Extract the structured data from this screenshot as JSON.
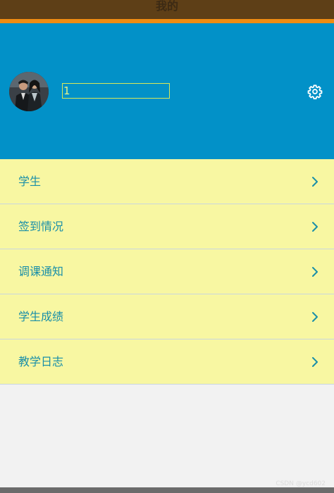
{
  "topbar": {
    "title": "我的"
  },
  "profile": {
    "username": "1"
  },
  "menu": {
    "items": [
      {
        "label": "学生"
      },
      {
        "label": "签到情况"
      },
      {
        "label": "调课通知"
      },
      {
        "label": "学生成绩"
      },
      {
        "label": "教学日志"
      }
    ]
  },
  "icons": {
    "settings": "gear-icon",
    "chevron": "chevron-right-icon"
  },
  "colors": {
    "topbar": "#5e3f17",
    "topbar_accent": "#f08c12",
    "header": "#0291c8",
    "menu_background": "#f8f7a2",
    "menu_text": "#1a8fa8",
    "page_background": "#f2f2f2"
  },
  "watermark": "CSDN @ycd602"
}
